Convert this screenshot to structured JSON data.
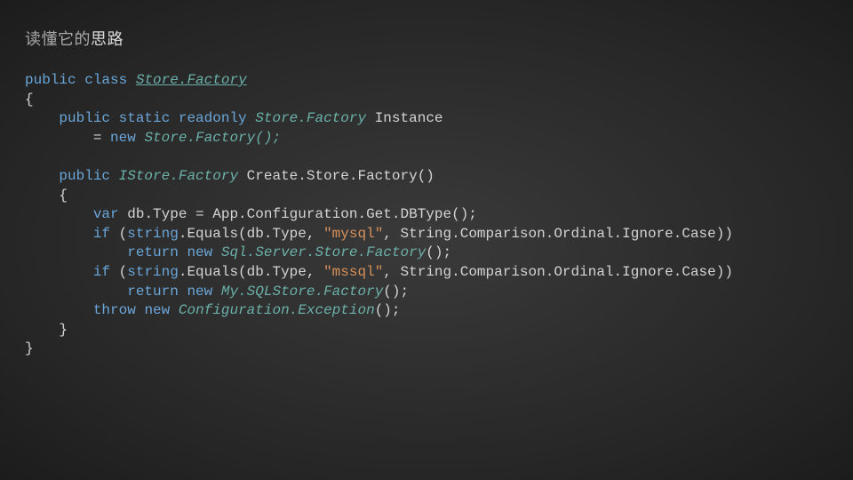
{
  "title": {
    "prefix": "读懂它的",
    "emph": "思路"
  },
  "code": {
    "kw_public": "public",
    "kw_class": "class",
    "kw_static": "static",
    "kw_readonly": "readonly",
    "kw_new": "new",
    "kw_var": "var",
    "kw_if": "if",
    "kw_return": "return",
    "kw_throw": "throw",
    "kw_string": "string",
    "type_StoreFactory": "Store.Factory",
    "type_IStoreFactory": "IStore.Factory",
    "type_SqlServerStoreFactory": "Sql.Server.Store.Factory",
    "type_MySQLStoreFactory": "My.SQLStore.Factory",
    "type_ConfigurationException": "Configuration.Exception",
    "id_Instance": "Instance",
    "call_ctor": "Store.Factory();",
    "method_name": "Create.Store.Factory()",
    "brace_open": "{",
    "brace_close": "}",
    "assign_dbType": "db.Type = App.Configuration.Get.DBType();",
    "equals_open1": ".Equals(db.Type, ",
    "str_mysql": "\"mysql\"",
    "str_mssql": "\"mssql\"",
    "equals_tail": ", String.Comparison.Ordinal.Ignore.Case))",
    "ctor_tail": "();",
    "if_open": "("
  }
}
